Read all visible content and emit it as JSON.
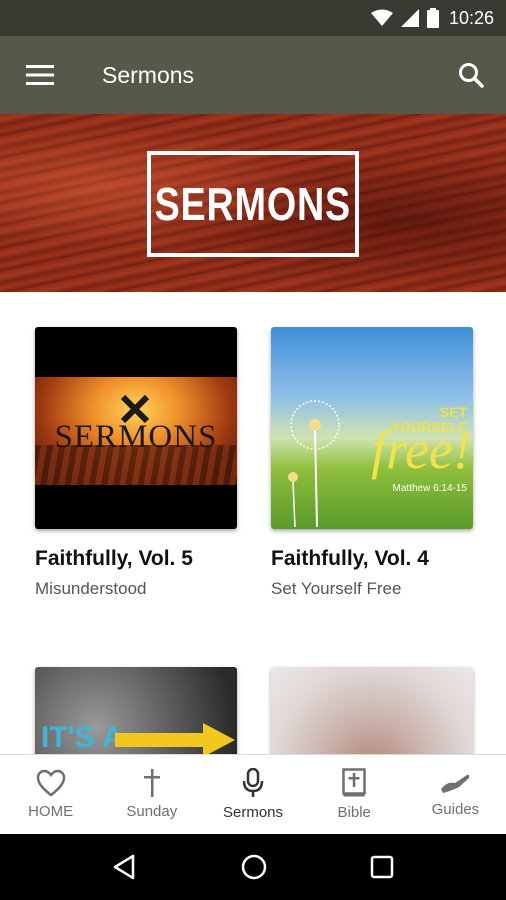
{
  "status_bar": {
    "time": "10:26"
  },
  "app_bar": {
    "title": "Sermons"
  },
  "hero": {
    "title": "SERMONS"
  },
  "cards": [
    {
      "title": "Faithfully, Vol. 5",
      "subtitle": "Misunderstood",
      "art_text": "SERMONS"
    },
    {
      "title": "Faithfully, Vol. 4",
      "subtitle": "Set Yourself Free",
      "art_text_1": "SET YOURSELF",
      "art_text_2": "free!",
      "art_text_3": "Matthew 6:14-15"
    },
    {
      "art_text": "IT'S A"
    },
    {}
  ],
  "bottom_nav": {
    "items": [
      {
        "label": "HOME",
        "icon": "heart-icon"
      },
      {
        "label": "Sunday",
        "icon": "cross-icon"
      },
      {
        "label": "Sermons",
        "icon": "microphone-icon",
        "active": true
      },
      {
        "label": "Bible",
        "icon": "bible-icon"
      },
      {
        "label": "Guides",
        "icon": "guides-icon"
      }
    ]
  },
  "colors": {
    "app_bar": "#58584a",
    "status_bar": "#3a3a33",
    "hero": "#8c2b18"
  }
}
